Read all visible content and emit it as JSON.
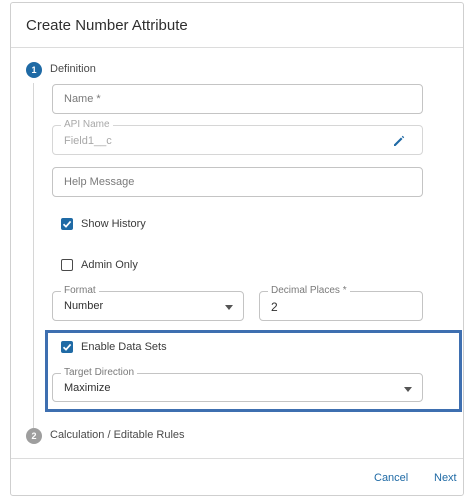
{
  "dialog": {
    "title": "Create Number Attribute",
    "cancel_label": "Cancel",
    "next_label": "Next"
  },
  "steps": [
    {
      "number": "1",
      "label": "Definition",
      "state": "active"
    },
    {
      "number": "2",
      "label": "Calculation / Editable Rules",
      "state": "inactive"
    }
  ],
  "form": {
    "name_placeholder": "Name *",
    "api_name": {
      "label": "API Name",
      "value": "Field1__c"
    },
    "help_placeholder": "Help Message",
    "show_history": {
      "label": "Show History",
      "checked": true
    },
    "admin_only": {
      "label": "Admin Only",
      "checked": false
    },
    "format": {
      "label": "Format",
      "value": "Number"
    },
    "decimal_places": {
      "label": "Decimal Places *",
      "value": "2"
    },
    "enable_data_sets": {
      "label": "Enable Data Sets",
      "checked": true
    },
    "target_direction": {
      "label": "Target Direction",
      "value": "Maximize"
    }
  },
  "icons": {
    "edit": "pencil-icon",
    "check": "check-icon",
    "dropdown": "chevron-down-icon"
  },
  "colors": {
    "accent": "#1f6aa5",
    "highlight": "#3e6fb0",
    "step_inactive": "#9e9e9e"
  }
}
